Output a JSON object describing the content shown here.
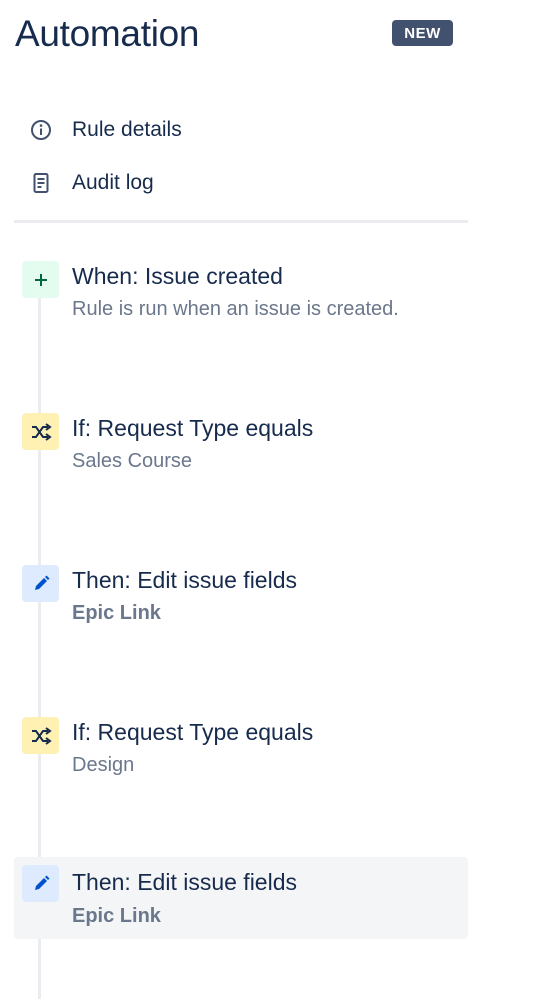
{
  "header": {
    "title": "Automation",
    "badge": "NEW"
  },
  "nav": {
    "items": [
      {
        "label": "Rule details",
        "icon": "info-icon"
      },
      {
        "label": "Audit log",
        "icon": "document-icon"
      }
    ]
  },
  "steps": [
    {
      "title": "When: Issue created",
      "subtitle": "Rule is run when an issue is created.",
      "icon": "plus-icon",
      "kind": "trigger"
    },
    {
      "title": "If: Request Type equals",
      "subtitle": "Sales Course",
      "icon": "shuffle-icon",
      "kind": "condition"
    },
    {
      "title": "Then: Edit issue fields",
      "subtitle": "Epic Link",
      "icon": "pencil-icon",
      "kind": "action"
    },
    {
      "title": "If: Request Type equals",
      "subtitle": "Design",
      "icon": "shuffle-icon",
      "kind": "condition"
    },
    {
      "title": "Then: Edit issue fields",
      "subtitle": "Epic Link",
      "icon": "pencil-icon",
      "kind": "action",
      "selected": true
    }
  ],
  "colors": {
    "text_primary": "#172B4D",
    "text_subtle": "#6B778C",
    "badge_bg": "#42526E",
    "trigger_bg": "#E3FCEF",
    "condition_bg": "#FFF0B3",
    "action_bg": "#DEEBFF",
    "action_icon": "#0052CC",
    "selected_bg": "#F4F5F7"
  }
}
